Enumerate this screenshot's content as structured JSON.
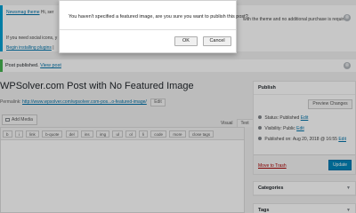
{
  "notice": {
    "brand_link": "Newsmag theme",
    "text_start": "Hi, ser",
    "text_right": "with the theme and no additional purchase is required!",
    "line2": "If you need social icons, y",
    "plugins_link": "Begin installing plugins",
    "plugins_sep": "|",
    "dismiss_glyph": "⊗"
  },
  "published_notice": {
    "text": "Post published.",
    "link": "View post",
    "dismiss_glyph": "⊗"
  },
  "post": {
    "title": "WPSolver.com Post with No Featured Image",
    "permalink_label": "Permalink:",
    "permalink_url": "http://www.wpsolver.com/wpsolver.com-pos...o-featured-image/",
    "permalink_edit": "Edit"
  },
  "editor": {
    "add_media": "Add Media",
    "tab_visual": "Visual",
    "tab_text": "Text",
    "quicktags": [
      "b",
      "i",
      "link",
      "b-quote",
      "del",
      "ins",
      "img",
      "ul",
      "ol",
      "li",
      "code",
      "more",
      "close tags"
    ]
  },
  "publish": {
    "title": "Publish",
    "preview": "Preview Changes",
    "status_label": "Status:",
    "status_value": "Published",
    "status_edit": "Edit",
    "visibility_label": "Visibility:",
    "visibility_value": "Public",
    "visibility_edit": "Edit",
    "published_on_label": "Published on:",
    "published_on_value": "Aug 20, 2018 @ 16:55",
    "published_on_edit": "Edit",
    "trash": "Move to Trash",
    "update": "Update"
  },
  "categories": {
    "title": "Categories"
  },
  "tags": {
    "title": "Tags"
  },
  "dialog": {
    "message": "You haven't specified a featured image, are you sure you want to publish this post?",
    "ok": "OK",
    "cancel": "Cancel"
  }
}
